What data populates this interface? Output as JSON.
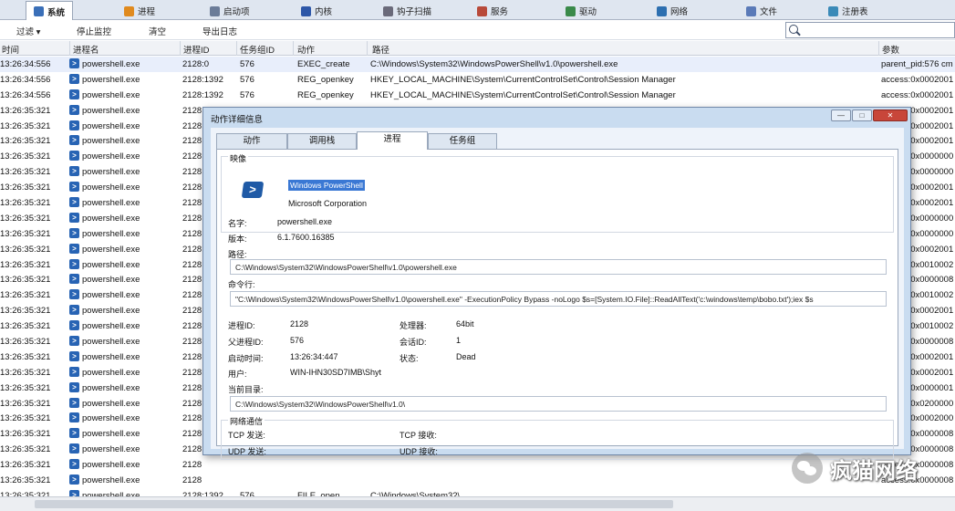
{
  "tabs": [
    {
      "label": "系统",
      "color": "#3a6fb8"
    },
    {
      "label": "进程",
      "color": "#e08a1e"
    },
    {
      "label": "启动项",
      "color": "#6b7c98"
    },
    {
      "label": "内核",
      "color": "#2d57a8"
    },
    {
      "label": "钩子扫描",
      "color": "#6a6a7a"
    },
    {
      "label": "服务",
      "color": "#b84a3a"
    },
    {
      "label": "驱动",
      "color": "#3a8a4a"
    },
    {
      "label": "网络",
      "color": "#2d6fb0"
    },
    {
      "label": "文件",
      "color": "#5a7ab8"
    },
    {
      "label": "注册表",
      "color": "#3a8ab8"
    }
  ],
  "toolbar": {
    "filter": "过滤 ▾",
    "stop_monitor": "停止监控",
    "clear": "清空",
    "export_log": "导出日志"
  },
  "columns": {
    "time": "时间",
    "process": "进程名",
    "pid": "进程ID",
    "task_id": "任务组ID",
    "action": "动作",
    "path": "路径",
    "params": "参数"
  },
  "rows": [
    {
      "time": "13:26:34:556",
      "process": "powershell.exe",
      "pid": "2128:0",
      "task_id": "576",
      "action": "EXEC_create",
      "path": "C:\\Windows\\System32\\WindowsPowerShell\\v1.0\\powershell.exe",
      "params": "parent_pid:576 cm"
    },
    {
      "time": "13:26:34:556",
      "process": "powershell.exe",
      "pid": "2128:1392",
      "task_id": "576",
      "action": "REG_openkey",
      "path": "HKEY_LOCAL_MACHINE\\System\\CurrentControlSet\\Control\\Session Manager",
      "params": "access:0x0002001"
    },
    {
      "time": "13:26:34:556",
      "process": "powershell.exe",
      "pid": "2128:1392",
      "task_id": "576",
      "action": "REG_openkey",
      "path": "HKEY_LOCAL_MACHINE\\System\\CurrentControlSet\\Control\\Session Manager",
      "params": "access:0x0002001"
    },
    {
      "time": "13:26:35:321",
      "process": "powershell.exe",
      "pid": "2128",
      "task_id": "",
      "action": "",
      "path": "",
      "params": "access:0x0002001"
    },
    {
      "time": "13:26:35:321",
      "process": "powershell.exe",
      "pid": "2128",
      "task_id": "",
      "action": "",
      "path": "",
      "params": "access:0x0002001"
    },
    {
      "time": "13:26:35:321",
      "process": "powershell.exe",
      "pid": "2128",
      "task_id": "",
      "action": "",
      "path": "",
      "params": "access:0x0002001"
    },
    {
      "time": "13:26:35:321",
      "process": "powershell.exe",
      "pid": "2128",
      "task_id": "",
      "action": "",
      "path": "",
      "params": "access:0x0000000"
    },
    {
      "time": "13:26:35:321",
      "process": "powershell.exe",
      "pid": "2128",
      "task_id": "",
      "action": "",
      "path": "",
      "params": "access:0x0000000"
    },
    {
      "time": "13:26:35:321",
      "process": "powershell.exe",
      "pid": "2128",
      "task_id": "",
      "action": "",
      "path": "",
      "params": "access:0x0002001"
    },
    {
      "time": "13:26:35:321",
      "process": "powershell.exe",
      "pid": "2128",
      "task_id": "",
      "action": "",
      "path": "",
      "params": "access:0x0002001"
    },
    {
      "time": "13:26:35:321",
      "process": "powershell.exe",
      "pid": "2128",
      "task_id": "",
      "action": "",
      "path": "",
      "params": "access:0x0000000"
    },
    {
      "time": "13:26:35:321",
      "process": "powershell.exe",
      "pid": "2128",
      "task_id": "",
      "action": "",
      "path": "",
      "params": "access:0x0000000"
    },
    {
      "time": "13:26:35:321",
      "process": "powershell.exe",
      "pid": "2128",
      "task_id": "",
      "action": "",
      "path": "",
      "params": "access:0x0002001"
    },
    {
      "time": "13:26:35:321",
      "process": "powershell.exe",
      "pid": "2128",
      "task_id": "",
      "action": "",
      "path": "",
      "params": "access:0x0010002"
    },
    {
      "time": "13:26:35:321",
      "process": "powershell.exe",
      "pid": "2128",
      "task_id": "",
      "action": "",
      "path": "",
      "params": "access:0x0000008"
    },
    {
      "time": "13:26:35:321",
      "process": "powershell.exe",
      "pid": "2128",
      "task_id": "",
      "action": "",
      "path": "",
      "params": "access:0x0010002"
    },
    {
      "time": "13:26:35:321",
      "process": "powershell.exe",
      "pid": "2128",
      "task_id": "",
      "action": "",
      "path": "",
      "params": "access:0x0002001"
    },
    {
      "time": "13:26:35:321",
      "process": "powershell.exe",
      "pid": "2128",
      "task_id": "",
      "action": "",
      "path": "",
      "params": "access:0x0010002"
    },
    {
      "time": "13:26:35:321",
      "process": "powershell.exe",
      "pid": "2128",
      "task_id": "",
      "action": "",
      "path": "",
      "params": "access:0x0000008"
    },
    {
      "time": "13:26:35:321",
      "process": "powershell.exe",
      "pid": "2128",
      "task_id": "",
      "action": "",
      "path": "",
      "params": "access:0x0002001"
    },
    {
      "time": "13:26:35:321",
      "process": "powershell.exe",
      "pid": "2128",
      "task_id": "",
      "action": "",
      "path": "",
      "params": "access:0x0002001"
    },
    {
      "time": "13:26:35:321",
      "process": "powershell.exe",
      "pid": "2128",
      "task_id": "",
      "action": "",
      "path": "",
      "params": "access:0x0000001"
    },
    {
      "time": "13:26:35:321",
      "process": "powershell.exe",
      "pid": "2128",
      "task_id": "",
      "action": "",
      "path": "",
      "params": "access:0x0200000"
    },
    {
      "time": "13:26:35:321",
      "process": "powershell.exe",
      "pid": "2128",
      "task_id": "",
      "action": "",
      "path": "",
      "params": "access:0x0002000"
    },
    {
      "time": "13:26:35:321",
      "process": "powershell.exe",
      "pid": "2128",
      "task_id": "",
      "action": "",
      "path": "",
      "params": "access:0x0000008"
    },
    {
      "time": "13:26:35:321",
      "process": "powershell.exe",
      "pid": "2128",
      "task_id": "",
      "action": "",
      "path": "",
      "params": "access:0x0000008"
    },
    {
      "time": "13:26:35:321",
      "process": "powershell.exe",
      "pid": "2128",
      "task_id": "",
      "action": "",
      "path": "",
      "params": "access:0x0000008"
    },
    {
      "time": "13:26:35:321",
      "process": "powershell.exe",
      "pid": "2128",
      "task_id": "",
      "action": "",
      "path": "",
      "params": "access:0x0000008"
    },
    {
      "time": "13:26:35:321",
      "process": "powershell.exe",
      "pid": "2128:1392",
      "task_id": "576",
      "action": "FILE_open",
      "path": "C:\\Windows\\System32\\...",
      "params": ""
    }
  ],
  "dialog": {
    "title": "动作详细信息",
    "win_min": "—",
    "win_max": "□",
    "win_close": "✕",
    "tabs": [
      "动作",
      "调用栈",
      "进程",
      "任务组"
    ],
    "image_section": "映像",
    "image_name": "Windows PowerShell",
    "company": "Microsoft Corporation",
    "name_label": "名字:",
    "name_value": "powershell.exe",
    "version_label": "版本:",
    "version_value": "6.1.7600.16385",
    "path_label": "路径:",
    "path_value": "C:\\Windows\\System32\\WindowsPowerShell\\v1.0\\powershell.exe",
    "cmdline_label": "命令行:",
    "cmdline_value": "\"C:\\Windows\\System32\\WindowsPowerShell\\v1.0\\powershell.exe\" -ExecutionPolicy Bypass -noLogo $s=[System.IO.File]::ReadAllText('c:\\windows\\temp\\bobo.txt');iex $s",
    "pid_label": "进程ID:",
    "pid_value": "2128",
    "arch_label": "处理器:",
    "arch_value": "64bit",
    "ppid_label": "父进程ID:",
    "ppid_value": "576",
    "session_label": "会话ID:",
    "session_value": "1",
    "start_label": "启动时间:",
    "start_value": "13:26:34:447",
    "state_label": "状态:",
    "state_value": "Dead",
    "user_label": "用户:",
    "user_value": "WIN-IHN30SD7IMB\\Shyt",
    "cwd_label": "当前目录:",
    "cwd_value": "C:\\Windows\\System32\\WindowsPowerShell\\v1.0\\",
    "net_section": "网络通信",
    "tcp_send": "TCP 发送:",
    "tcp_recv": "TCP 接收:",
    "udp_send": "UDP 发送:",
    "udp_recv": "UDP 接收:"
  },
  "watermark": {
    "text": "疯猫网络"
  }
}
